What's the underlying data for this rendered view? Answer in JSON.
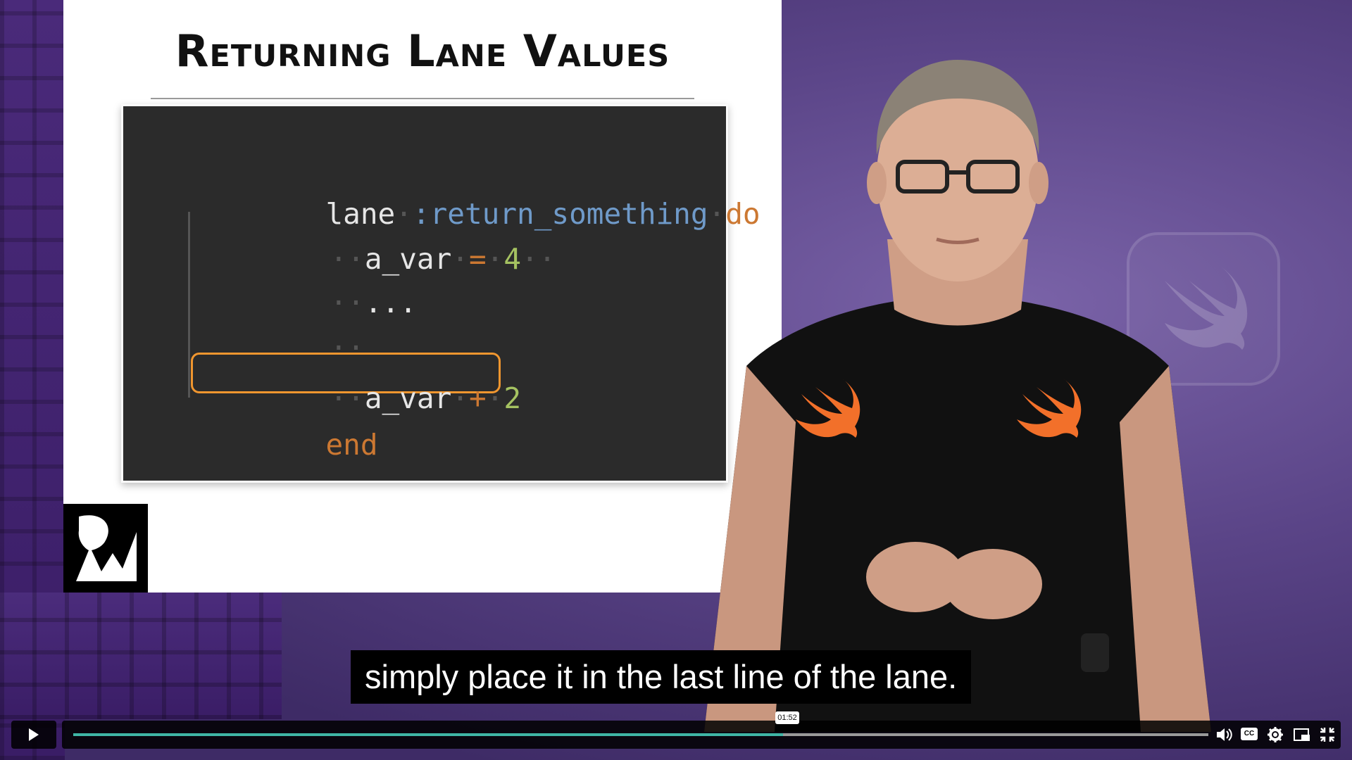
{
  "slide": {
    "title": "Returning Lane Values",
    "code": {
      "line1": {
        "kw": "lane",
        "sym": ":return_something",
        "do": "do"
      },
      "line2": {
        "var": "a_var",
        "op": "=",
        "num": "4"
      },
      "line3": "...",
      "line5": {
        "var": "a_var",
        "op": "+",
        "num": "2"
      },
      "line6": "end"
    }
  },
  "caption": "simply place it in the last line of the lane.",
  "player": {
    "current_time": "01:52",
    "progress": 0.625,
    "icons": [
      "play-icon",
      "volume-icon",
      "closed-captions-icon",
      "settings-icon",
      "picture-in-picture-icon",
      "exit-fullscreen-icon"
    ],
    "cc_label": "CC"
  },
  "colors": {
    "progress_fill": "#3fb6a6",
    "highlight": "#f0962f",
    "swift_orange": "#f2702a"
  }
}
